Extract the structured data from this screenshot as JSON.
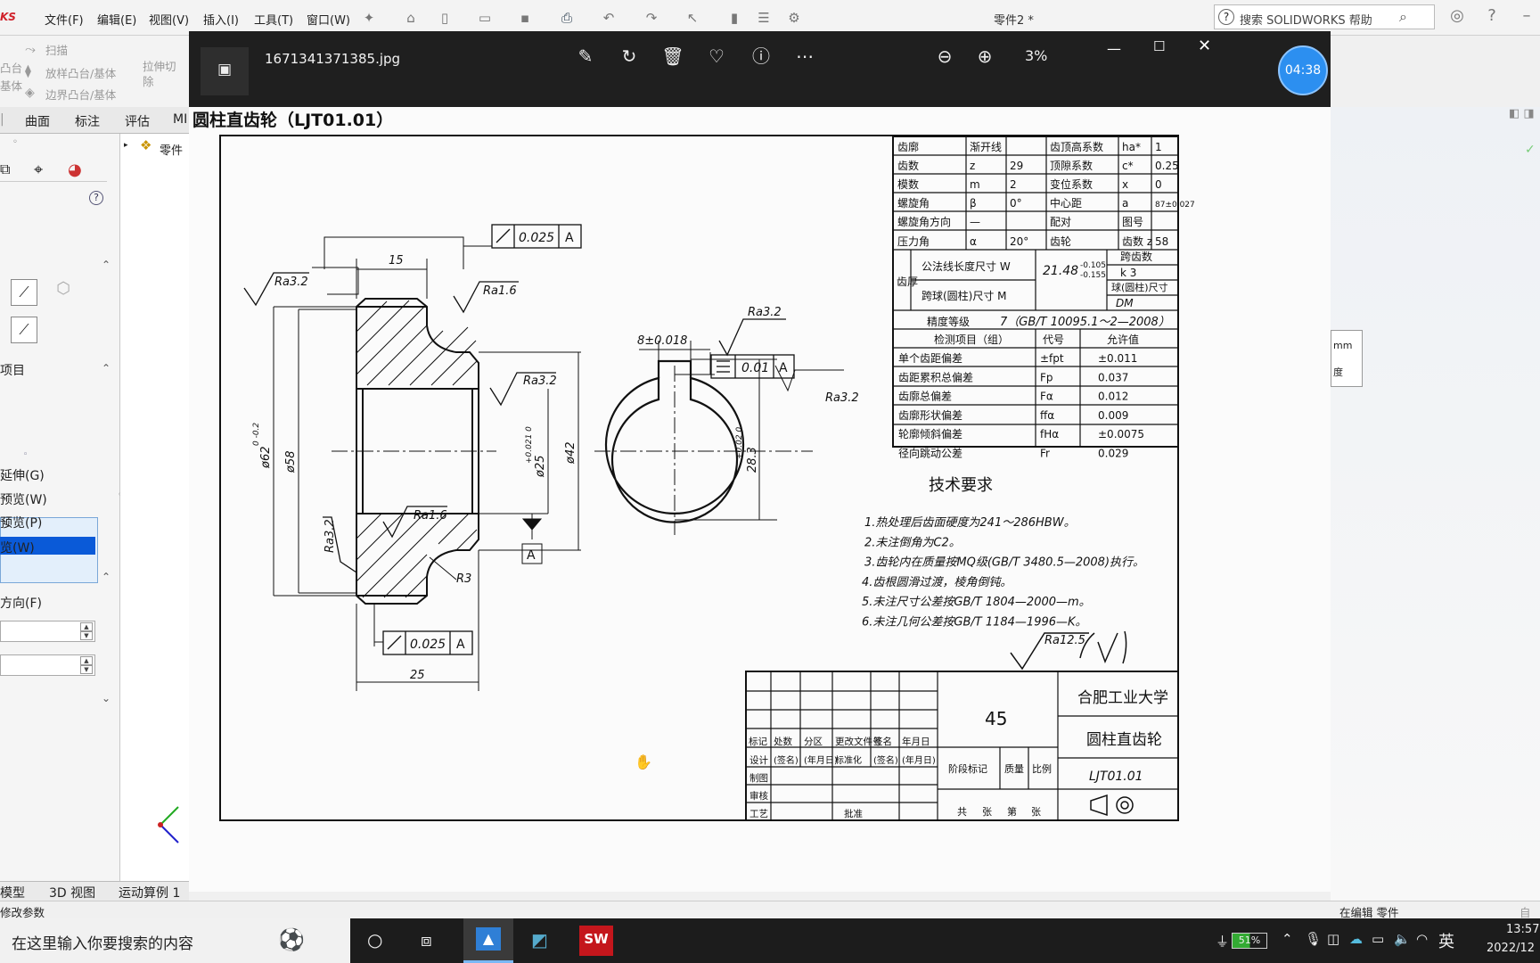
{
  "solidworks": {
    "logo_fragment": "KS",
    "menus": [
      "文件(F)",
      "编辑(E)",
      "视图(V)",
      "插入(I)",
      "工具(T)",
      "窗口(W)"
    ],
    "document_title": "零件2 *",
    "help_search_placeholder": "搜索 SOLIDWORKS 帮助",
    "command_manager": {
      "sweep": "扫描",
      "loft_boss": "放样凸台/基体",
      "boundary_boss": "边界凸台/基体",
      "extrude_cut": "拉伸切除",
      "boss_fragment_1": "凸台",
      "boss_fragment_2": "基体"
    },
    "tabs": [
      "曲面",
      "标注",
      "评估",
      "MI"
    ],
    "feature_tree_root": "零件",
    "left_panel": {
      "items_header": "项目",
      "extend": "延伸(G)",
      "preview_w": "预览(W)",
      "preview_p": "预览(P)",
      "preview_w2": "览(W)",
      "direction": "方向(F)"
    },
    "bottom_tabs": [
      "模型",
      "3D 视图",
      "运动算例 1"
    ],
    "status_left": "修改参数",
    "status_right": "在编辑 零件",
    "status_far_right": "自定",
    "right_tooltip_1": "mm",
    "right_tooltip_2": "度"
  },
  "viewer": {
    "filename": "1671341371385.jpg",
    "zoom_fragment": "3%",
    "timer": "04:38"
  },
  "drawing": {
    "title": "圆柱直齿轮（LJT01.01）",
    "gear_params": [
      [
        "齿廓",
        "渐开线",
        "",
        "齿顶高系数",
        "ha*",
        "1"
      ],
      [
        "齿数",
        "z",
        "29",
        "顶隙系数",
        "c*",
        "0.25"
      ],
      [
        "模数",
        "m",
        "2",
        "变位系数",
        "x",
        "0"
      ],
      [
        "螺旋角",
        "β",
        "0°",
        "中心距",
        "a",
        "87±0.027"
      ],
      [
        "螺旋角方向",
        "—",
        "",
        "配对",
        "图号",
        ""
      ],
      [
        "压力角",
        "α",
        "20°",
        "齿轮",
        "齿数 z",
        "58"
      ]
    ],
    "tooth_thickness_label": "齿厚",
    "common_normal_label": "公法线长度尺寸 W",
    "common_normal_value": "21.48",
    "common_normal_tol_upper": "-0.105",
    "common_normal_tol_lower": "-0.155",
    "span_teeth_label": "跨齿数",
    "span_teeth": "k 3",
    "ball_label": "跨球(圆柱)尺寸 M",
    "ball_size_label": "球(圆柱)尺寸",
    "ball_dm": "DM",
    "accuracy_grade_label": "精度等级",
    "accuracy_grade": "7（GB/T 10095.1～2—2008）",
    "check_header": [
      "检测项目（组）",
      "代号",
      "允许值"
    ],
    "checks": [
      [
        "单个齿距偏差",
        "±fpt",
        "±0.011"
      ],
      [
        "齿距累积总偏差",
        "Fp",
        "0.037"
      ],
      [
        "齿廓总偏差",
        "Fα",
        "0.012"
      ],
      [
        "齿廓形状偏差",
        "ffα",
        "0.009"
      ],
      [
        "轮廓倾斜偏差",
        "fHα",
        "±0.0075"
      ],
      [
        "径向跳动公差",
        "Fr",
        "0.029"
      ]
    ],
    "tech_title": "技术要求",
    "tech_reqs": [
      "1.热处理后齿面硬度为241～286HBW。",
      "2.未注倒角为C2。",
      "3.齿轮内在质量按MQ级(GB/T 3480.5—2008)执行。",
      "4.齿根圆滑过渡，棱角倒钝。",
      "5.未注尺寸公差按GB/T 1804—2000—m。",
      "6.未注几何公差按GB/T 1184—1996—K。"
    ],
    "general_roughness": "Ra12.5",
    "material": "45",
    "school": "合肥工业大学",
    "part_name": "圆柱直齿轮",
    "part_code": "LJT01.01",
    "title_block_headers": [
      "标记",
      "处数",
      "分区",
      "更改文件号",
      "签名",
      "年月日"
    ],
    "title_block_sub": [
      "(签名)",
      "(年月日)",
      "标准化",
      "(签名)",
      "(年月日)"
    ],
    "title_block_rows": [
      "设计",
      "制图",
      "审核",
      "工艺"
    ],
    "title_block_approve": "批准",
    "title_block_stage": [
      "阶段标记",
      "质量",
      "比例"
    ],
    "sheet_info": [
      "共",
      "张",
      "第",
      "张"
    ],
    "dims": {
      "d62": "ø62",
      "d62_tol": "0 -0.2",
      "d58": "ø58",
      "d25": "ø25",
      "d25_tol": "+0.021 0",
      "d42": "ø42",
      "w15": "15",
      "w25": "25",
      "key_w": "8±0.018",
      "key_h": "28.3",
      "key_h_tol": "+0.02 0",
      "r3": "R3",
      "runout1": "0.025",
      "runout2": "0.025",
      "sym": "0.01",
      "datum": "A",
      "ra32": "Ra3.2",
      "ra16": "Ra1.6"
    }
  },
  "taskbar": {
    "search_placeholder": "在这里输入你要搜索的内容",
    "battery": "51%",
    "ime": "英",
    "time": "13:57",
    "date": "2022/12"
  }
}
